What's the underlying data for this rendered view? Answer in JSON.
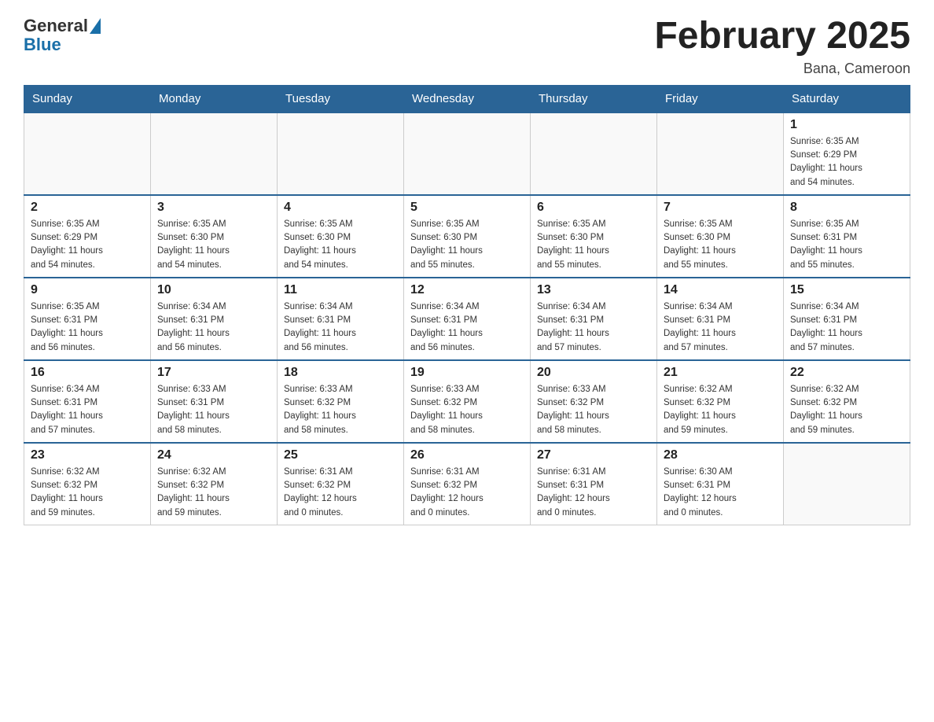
{
  "logo": {
    "general": "General",
    "blue": "Blue"
  },
  "title": "February 2025",
  "subtitle": "Bana, Cameroon",
  "days_of_week": [
    "Sunday",
    "Monday",
    "Tuesday",
    "Wednesday",
    "Thursday",
    "Friday",
    "Saturday"
  ],
  "weeks": [
    [
      {
        "day": "",
        "info": ""
      },
      {
        "day": "",
        "info": ""
      },
      {
        "day": "",
        "info": ""
      },
      {
        "day": "",
        "info": ""
      },
      {
        "day": "",
        "info": ""
      },
      {
        "day": "",
        "info": ""
      },
      {
        "day": "1",
        "info": "Sunrise: 6:35 AM\nSunset: 6:29 PM\nDaylight: 11 hours\nand 54 minutes."
      }
    ],
    [
      {
        "day": "2",
        "info": "Sunrise: 6:35 AM\nSunset: 6:29 PM\nDaylight: 11 hours\nand 54 minutes."
      },
      {
        "day": "3",
        "info": "Sunrise: 6:35 AM\nSunset: 6:30 PM\nDaylight: 11 hours\nand 54 minutes."
      },
      {
        "day": "4",
        "info": "Sunrise: 6:35 AM\nSunset: 6:30 PM\nDaylight: 11 hours\nand 54 minutes."
      },
      {
        "day": "5",
        "info": "Sunrise: 6:35 AM\nSunset: 6:30 PM\nDaylight: 11 hours\nand 55 minutes."
      },
      {
        "day": "6",
        "info": "Sunrise: 6:35 AM\nSunset: 6:30 PM\nDaylight: 11 hours\nand 55 minutes."
      },
      {
        "day": "7",
        "info": "Sunrise: 6:35 AM\nSunset: 6:30 PM\nDaylight: 11 hours\nand 55 minutes."
      },
      {
        "day": "8",
        "info": "Sunrise: 6:35 AM\nSunset: 6:31 PM\nDaylight: 11 hours\nand 55 minutes."
      }
    ],
    [
      {
        "day": "9",
        "info": "Sunrise: 6:35 AM\nSunset: 6:31 PM\nDaylight: 11 hours\nand 56 minutes."
      },
      {
        "day": "10",
        "info": "Sunrise: 6:34 AM\nSunset: 6:31 PM\nDaylight: 11 hours\nand 56 minutes."
      },
      {
        "day": "11",
        "info": "Sunrise: 6:34 AM\nSunset: 6:31 PM\nDaylight: 11 hours\nand 56 minutes."
      },
      {
        "day": "12",
        "info": "Sunrise: 6:34 AM\nSunset: 6:31 PM\nDaylight: 11 hours\nand 56 minutes."
      },
      {
        "day": "13",
        "info": "Sunrise: 6:34 AM\nSunset: 6:31 PM\nDaylight: 11 hours\nand 57 minutes."
      },
      {
        "day": "14",
        "info": "Sunrise: 6:34 AM\nSunset: 6:31 PM\nDaylight: 11 hours\nand 57 minutes."
      },
      {
        "day": "15",
        "info": "Sunrise: 6:34 AM\nSunset: 6:31 PM\nDaylight: 11 hours\nand 57 minutes."
      }
    ],
    [
      {
        "day": "16",
        "info": "Sunrise: 6:34 AM\nSunset: 6:31 PM\nDaylight: 11 hours\nand 57 minutes."
      },
      {
        "day": "17",
        "info": "Sunrise: 6:33 AM\nSunset: 6:31 PM\nDaylight: 11 hours\nand 58 minutes."
      },
      {
        "day": "18",
        "info": "Sunrise: 6:33 AM\nSunset: 6:32 PM\nDaylight: 11 hours\nand 58 minutes."
      },
      {
        "day": "19",
        "info": "Sunrise: 6:33 AM\nSunset: 6:32 PM\nDaylight: 11 hours\nand 58 minutes."
      },
      {
        "day": "20",
        "info": "Sunrise: 6:33 AM\nSunset: 6:32 PM\nDaylight: 11 hours\nand 58 minutes."
      },
      {
        "day": "21",
        "info": "Sunrise: 6:32 AM\nSunset: 6:32 PM\nDaylight: 11 hours\nand 59 minutes."
      },
      {
        "day": "22",
        "info": "Sunrise: 6:32 AM\nSunset: 6:32 PM\nDaylight: 11 hours\nand 59 minutes."
      }
    ],
    [
      {
        "day": "23",
        "info": "Sunrise: 6:32 AM\nSunset: 6:32 PM\nDaylight: 11 hours\nand 59 minutes."
      },
      {
        "day": "24",
        "info": "Sunrise: 6:32 AM\nSunset: 6:32 PM\nDaylight: 11 hours\nand 59 minutes."
      },
      {
        "day": "25",
        "info": "Sunrise: 6:31 AM\nSunset: 6:32 PM\nDaylight: 12 hours\nand 0 minutes."
      },
      {
        "day": "26",
        "info": "Sunrise: 6:31 AM\nSunset: 6:32 PM\nDaylight: 12 hours\nand 0 minutes."
      },
      {
        "day": "27",
        "info": "Sunrise: 6:31 AM\nSunset: 6:31 PM\nDaylight: 12 hours\nand 0 minutes."
      },
      {
        "day": "28",
        "info": "Sunrise: 6:30 AM\nSunset: 6:31 PM\nDaylight: 12 hours\nand 0 minutes."
      },
      {
        "day": "",
        "info": ""
      }
    ]
  ]
}
